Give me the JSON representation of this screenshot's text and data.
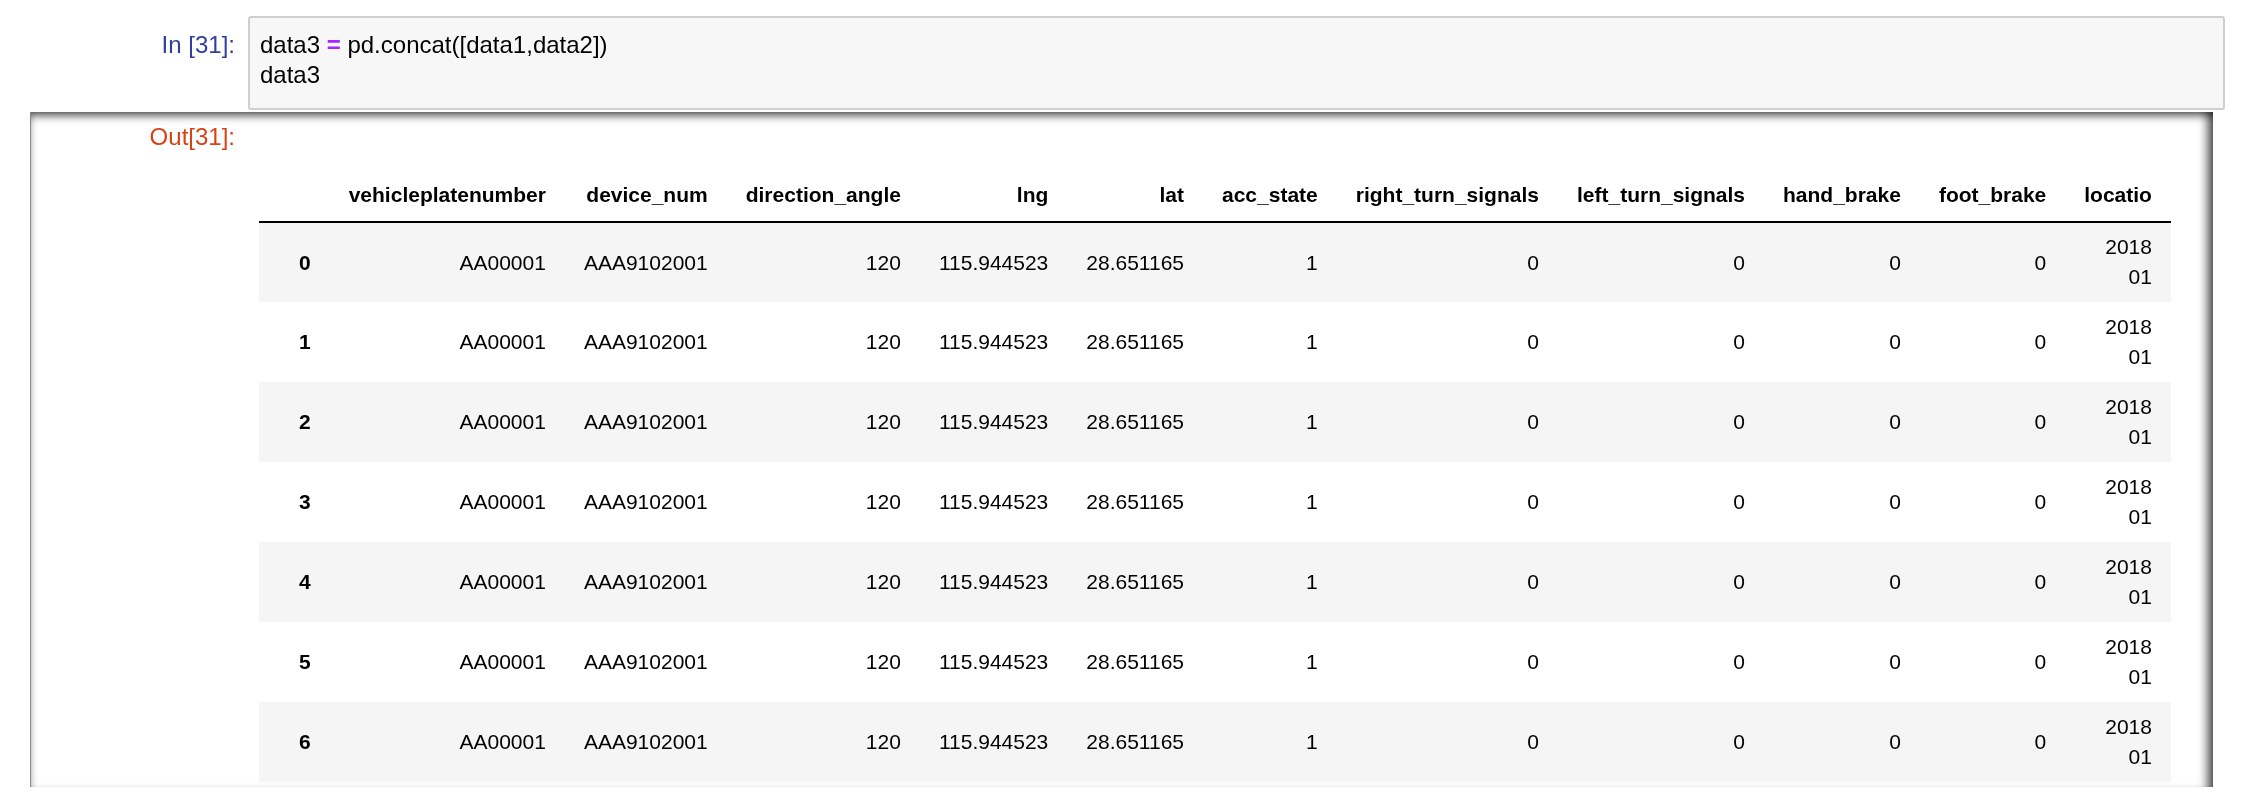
{
  "input_cell": {
    "prompt": "In [31]:",
    "code_lines": [
      {
        "parts": [
          {
            "kind": "name",
            "text": "data3"
          },
          {
            "kind": "operator",
            "text": "="
          },
          {
            "kind": "name",
            "text": "pd.concat([data1,data2])"
          }
        ]
      },
      {
        "parts": [
          {
            "kind": "name",
            "text": "data3"
          }
        ]
      }
    ]
  },
  "output_cell": {
    "prompt": "Out[31]:",
    "table": {
      "columns": [
        "vehicleplatenumber",
        "device_num",
        "direction_angle",
        "lng",
        "lat",
        "acc_state",
        "right_turn_signals",
        "left_turn_signals",
        "hand_brake",
        "foot_brake",
        "locatio"
      ],
      "rows": [
        {
          "index": "0",
          "cells": [
            "AA00001",
            "AAA9102001",
            "120",
            "115.944523",
            "28.651165",
            "1",
            "0",
            "0",
            "0",
            "0",
            [
              "2018",
              "01"
            ]
          ]
        },
        {
          "index": "1",
          "cells": [
            "AA00001",
            "AAA9102001",
            "120",
            "115.944523",
            "28.651165",
            "1",
            "0",
            "0",
            "0",
            "0",
            [
              "2018",
              "01"
            ]
          ]
        },
        {
          "index": "2",
          "cells": [
            "AA00001",
            "AAA9102001",
            "120",
            "115.944523",
            "28.651165",
            "1",
            "0",
            "0",
            "0",
            "0",
            [
              "2018",
              "01"
            ]
          ]
        },
        {
          "index": "3",
          "cells": [
            "AA00001",
            "AAA9102001",
            "120",
            "115.944523",
            "28.651165",
            "1",
            "0",
            "0",
            "0",
            "0",
            [
              "2018",
              "01"
            ]
          ]
        },
        {
          "index": "4",
          "cells": [
            "AA00001",
            "AAA9102001",
            "120",
            "115.944523",
            "28.651165",
            "1",
            "0",
            "0",
            "0",
            "0",
            [
              "2018",
              "01"
            ]
          ]
        },
        {
          "index": "5",
          "cells": [
            "AA00001",
            "AAA9102001",
            "120",
            "115.944523",
            "28.651165",
            "1",
            "0",
            "0",
            "0",
            "0",
            [
              "2018",
              "01"
            ]
          ]
        },
        {
          "index": "6",
          "cells": [
            "AA00001",
            "AAA9102001",
            "120",
            "115.944523",
            "28.651165",
            "1",
            "0",
            "0",
            "0",
            "0",
            [
              "2018",
              "01"
            ]
          ]
        }
      ]
    }
  }
}
